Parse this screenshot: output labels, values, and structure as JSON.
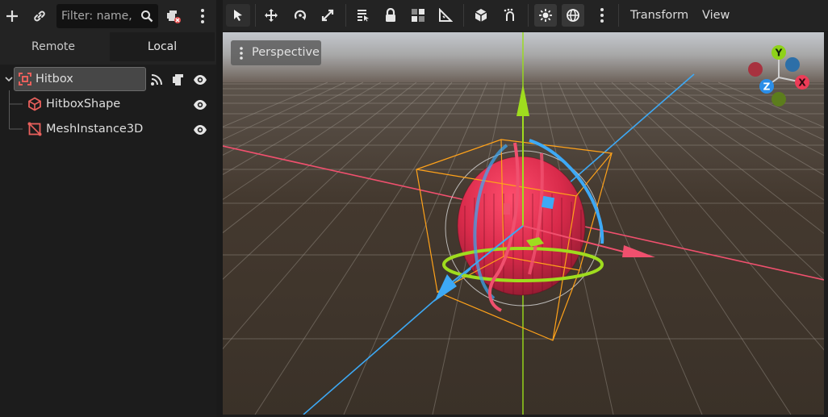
{
  "scene_dock": {
    "filter_placeholder": "Filter: name,",
    "tabs": {
      "remote": "Remote",
      "local": "Local"
    },
    "nodes": [
      {
        "name": "Hitbox",
        "icon": "area3d-icon",
        "selected": true
      },
      {
        "name": "HitboxShape",
        "icon": "collision-shape-icon"
      },
      {
        "name": "MeshInstance3D",
        "icon": "mesh-instance-icon"
      }
    ]
  },
  "viewport_toolbar": {
    "menus": {
      "transform": "Transform",
      "view": "View"
    }
  },
  "viewport": {
    "perspective_label": "Perspective",
    "gizmo_axes": {
      "x": "X",
      "y": "Y",
      "z": "Z"
    }
  },
  "colors": {
    "x_axis": "#f0506e",
    "y_axis": "#99dd1a",
    "z_axis": "#3da9f5",
    "selection_box": "#ffa21a",
    "node_icon_red": "#e8605c",
    "sphere_red": "#d82a4a"
  }
}
